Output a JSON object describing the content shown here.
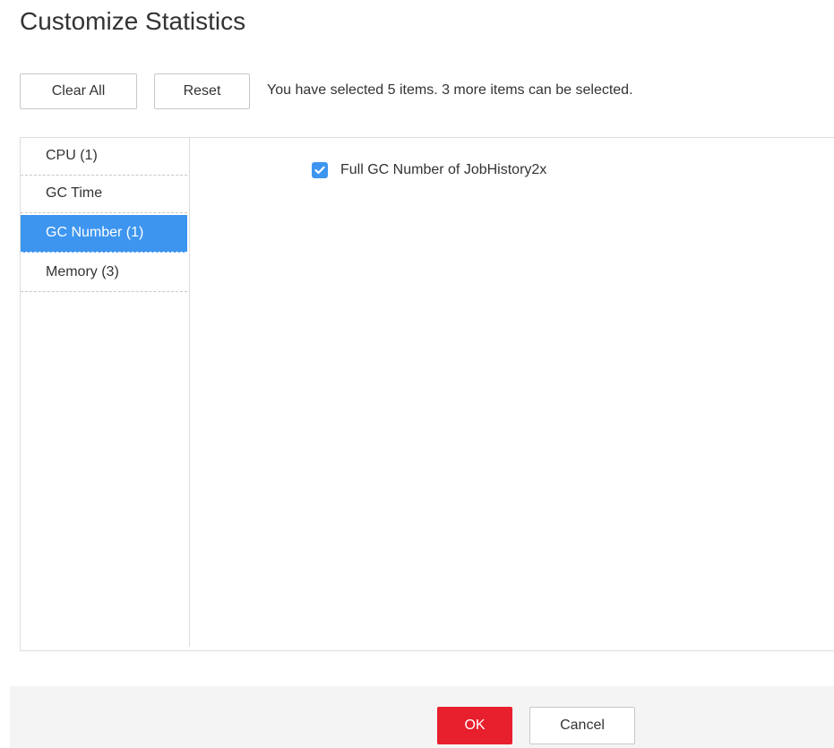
{
  "dialog": {
    "title": "Customize Statistics"
  },
  "toolbar": {
    "clear_all_label": "Clear All",
    "reset_label": "Reset",
    "selection_info": "You have selected 5 items. 3 more items can be selected."
  },
  "categories": [
    {
      "label": "CPU (1)",
      "selected": false
    },
    {
      "label": "GC Time",
      "selected": false
    },
    {
      "label": "GC Number (1)",
      "selected": true
    },
    {
      "label": "Memory (3)",
      "selected": false
    }
  ],
  "items": [
    {
      "label": "Full GC Number of JobHistory2x",
      "checked": true
    }
  ],
  "footer": {
    "ok_label": "OK",
    "cancel_label": "Cancel"
  },
  "colors": {
    "accent": "#3d95f0",
    "primary_button": "#e81f2d",
    "footer_bg": "#f4f4f4"
  },
  "icons": {
    "checkbox": "check-icon"
  }
}
